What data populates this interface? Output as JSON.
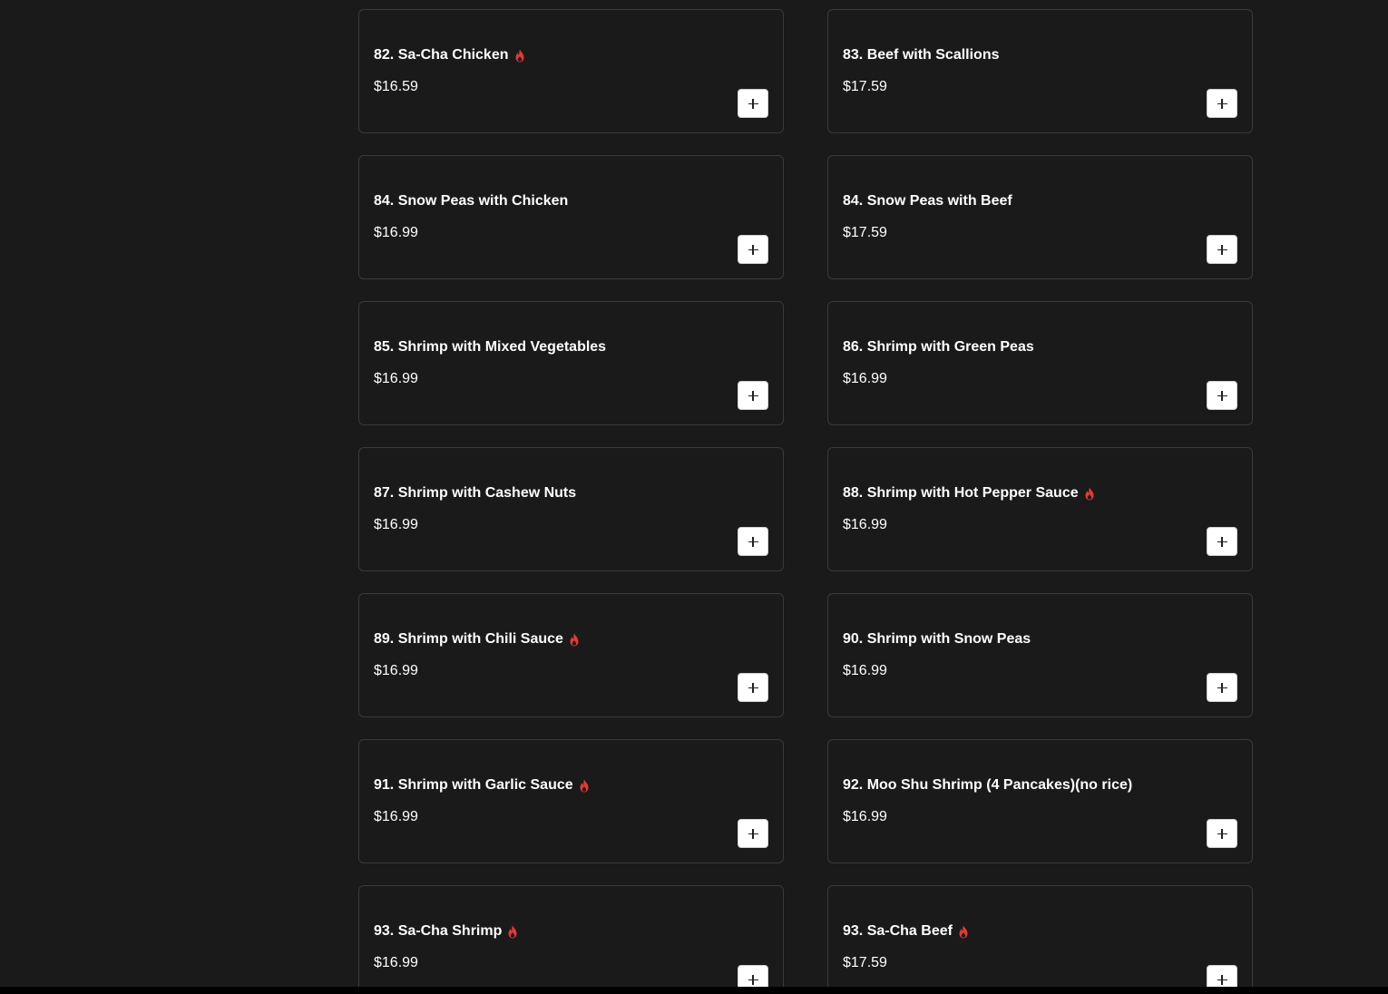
{
  "colors": {
    "page_background": "#1a1a1a",
    "card_border": "#3a3a3a",
    "text": "#ffffff",
    "spicy": "#e53935",
    "button_background": "#ffffff"
  },
  "icons": {
    "spicy": "flame-icon",
    "add": "plus-icon"
  },
  "menu_items": [
    {
      "name": "82. Sa-Cha Chicken",
      "price": "$16.59",
      "spicy": true
    },
    {
      "name": "83. Beef with Scallions",
      "price": "$17.59",
      "spicy": false
    },
    {
      "name": "84. Snow Peas with Chicken",
      "price": "$16.99",
      "spicy": false
    },
    {
      "name": "84. Snow Peas with Beef",
      "price": "$17.59",
      "spicy": false
    },
    {
      "name": "85. Shrimp with Mixed Vegetables",
      "price": "$16.99",
      "spicy": false
    },
    {
      "name": "86. Shrimp with Green Peas",
      "price": "$16.99",
      "spicy": false
    },
    {
      "name": "87. Shrimp with Cashew Nuts",
      "price": "$16.99",
      "spicy": false
    },
    {
      "name": "88. Shrimp with Hot Pepper Sauce",
      "price": "$16.99",
      "spicy": true
    },
    {
      "name": "89. Shrimp with Chili Sauce",
      "price": "$16.99",
      "spicy": true
    },
    {
      "name": "90. Shrimp with Snow Peas",
      "price": "$16.99",
      "spicy": false
    },
    {
      "name": "91. Shrimp with Garlic Sauce",
      "price": "$16.99",
      "spicy": true
    },
    {
      "name": "92. Moo Shu Shrimp (4 Pancakes)(no rice)",
      "price": "$16.99",
      "spicy": false
    },
    {
      "name": "93. Sa-Cha Shrimp",
      "price": "$16.99",
      "spicy": true
    },
    {
      "name": "93. Sa-Cha Beef",
      "price": "$17.59",
      "spicy": true
    }
  ]
}
